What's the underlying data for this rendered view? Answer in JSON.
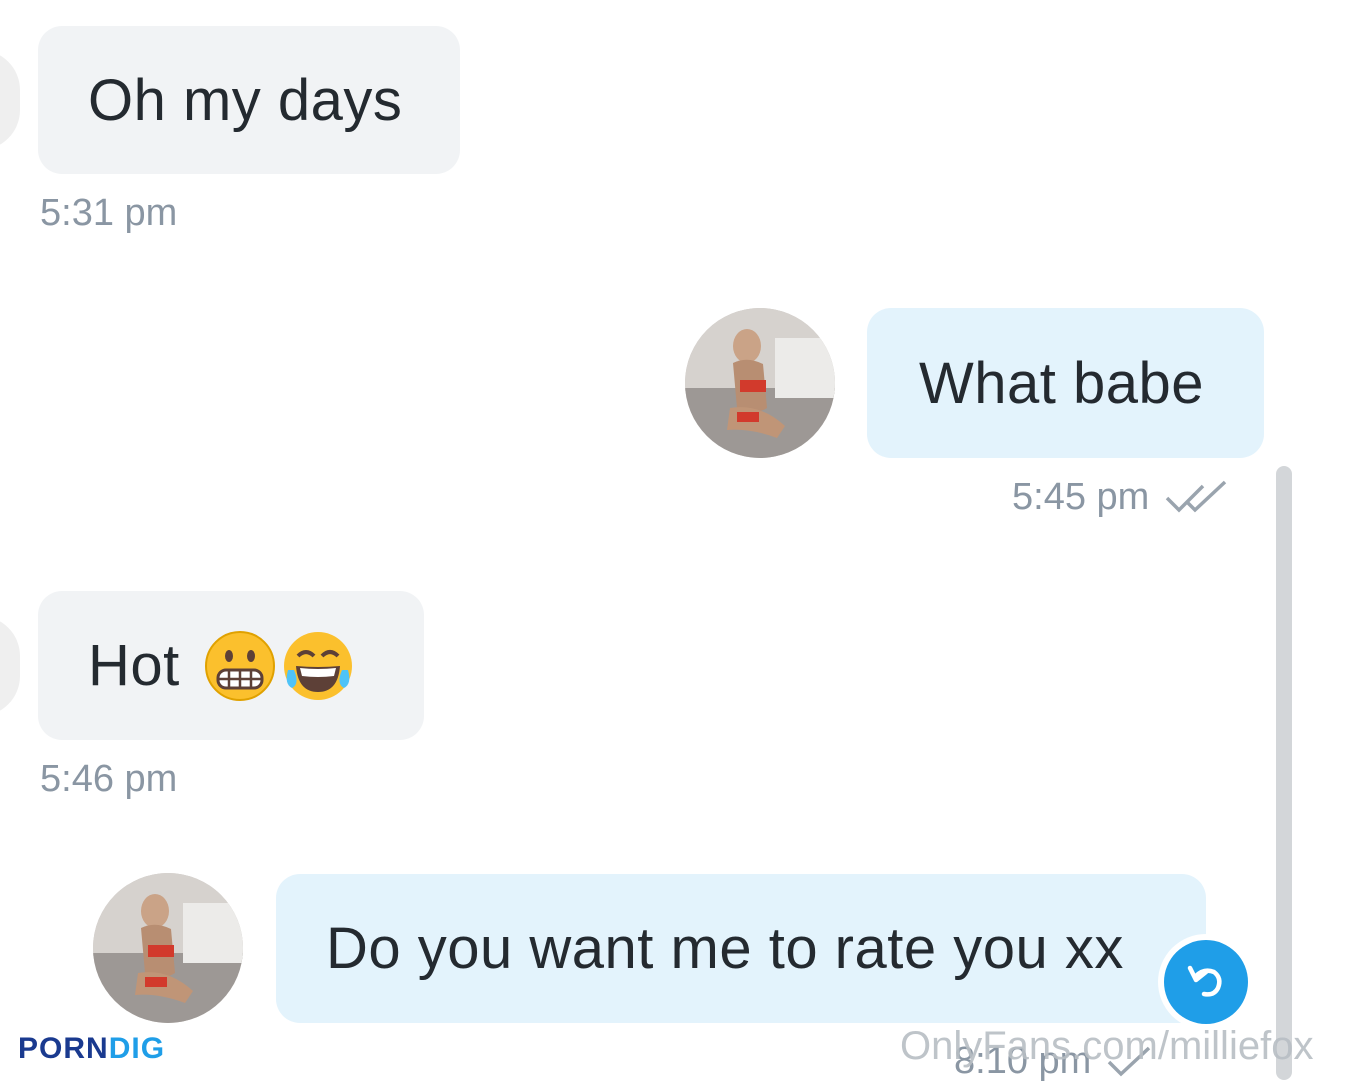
{
  "messages": [
    {
      "text": "Oh my days",
      "time": "5:31 pm"
    },
    {
      "text": "What babe",
      "time": "5:45 pm"
    },
    {
      "text": "Hot",
      "time": "5:46 pm",
      "emojis": [
        "grimacing-face",
        "face-with-tears-of-joy"
      ]
    },
    {
      "text": "Do you want me to rate you xx",
      "time": "8:10 pm"
    }
  ],
  "watermarks": {
    "left_part1": "PORN",
    "left_part2": "DIG",
    "right": "OnlyFans.com/milliefox"
  },
  "colors": {
    "incoming_bubble": "#f1f3f5",
    "outgoing_bubble": "#e3f3fc",
    "accent": "#1f9ee8",
    "timestamp": "#8a96a3"
  },
  "icons": [
    "double-check-icon",
    "single-check-icon",
    "reply-icon"
  ]
}
